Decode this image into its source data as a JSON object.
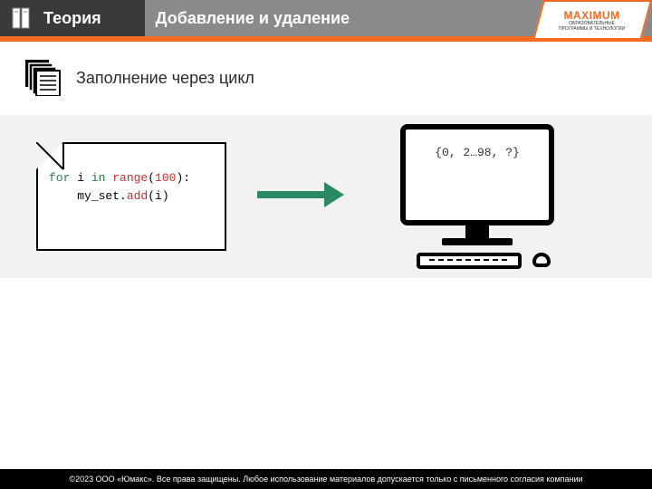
{
  "header": {
    "section": "Теория",
    "title": "Добавление и удаление",
    "brand_name": "MAXIMUM",
    "brand_tag_line1": "ОБРАЗОВАТЕЛЬНЫЕ",
    "brand_tag_line2": "ПРОГРАММЫ И ТЕХНОЛОГИИ"
  },
  "subtitle": "Заполнение через цикл",
  "code": {
    "kw_for": "for",
    "var_i": " i ",
    "kw_in": "in",
    "fn_range": " range",
    "paren_open": "(",
    "num_100": "100",
    "line1_end": "):",
    "indent": "    my_set.",
    "fn_add": "add",
    "line2_end": "(i)"
  },
  "monitor_output": "{0, 2…98, ?}",
  "footer": "©2023 ООО «Юмакс». Все права защищены. Любое использование материалов допускается только с письменного согласия компании"
}
